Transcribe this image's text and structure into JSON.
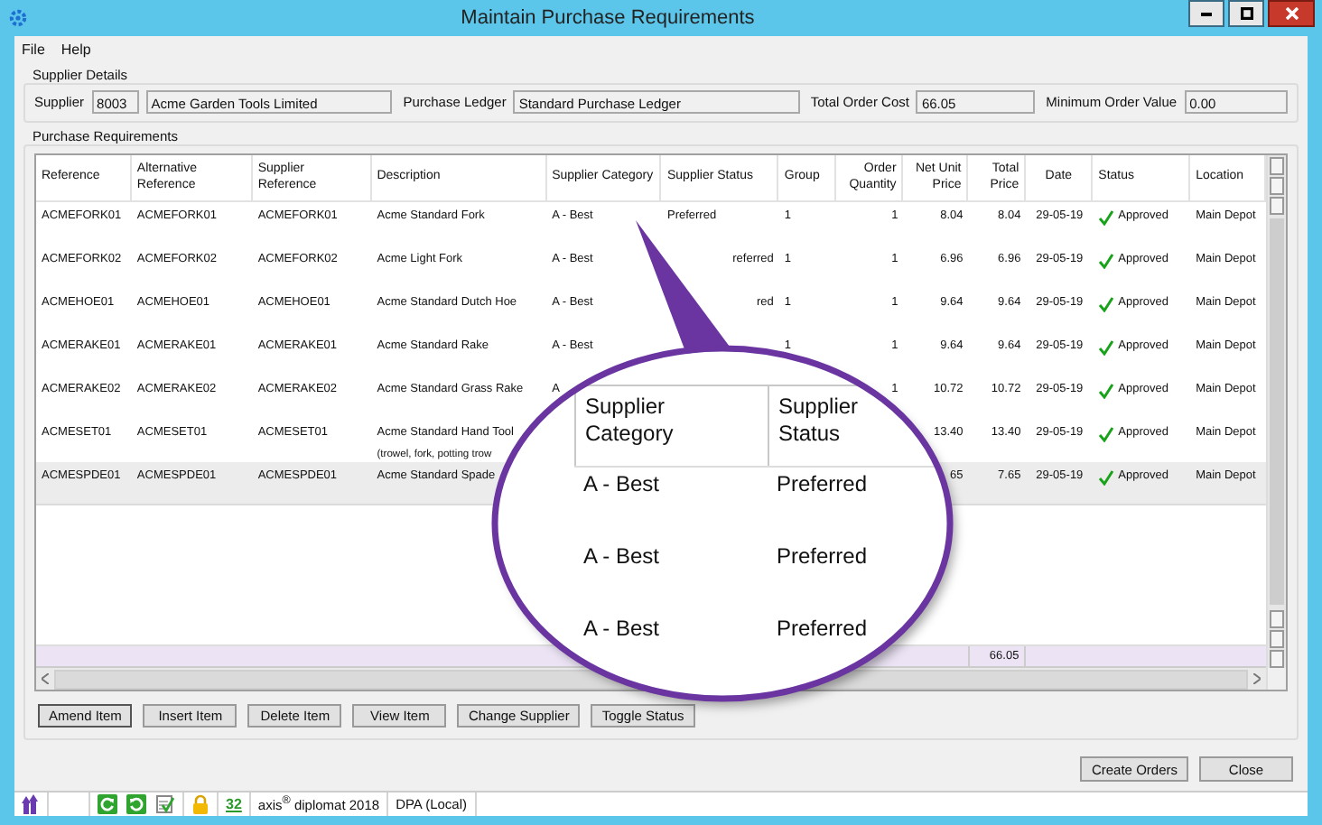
{
  "window": {
    "title": "Maintain Purchase Requirements"
  },
  "menu": [
    "File",
    "Help"
  ],
  "supplier_details": {
    "title": "Supplier Details",
    "fields": [
      {
        "label": "Supplier",
        "boxes": [
          "8003",
          "Acme Garden Tools Limited"
        ]
      },
      {
        "label": "Purchase Ledger",
        "boxes": [
          "Standard Purchase Ledger"
        ]
      },
      {
        "label": "Total Order Cost",
        "boxes": [
          "66.05"
        ]
      },
      {
        "label": "Minimum Order Value",
        "boxes": [
          "0.00"
        ]
      }
    ]
  },
  "requirements": {
    "title": "Purchase Requirements",
    "columns": [
      "Reference",
      "Alternative Reference",
      "Supplier Reference",
      "Description",
      "Supplier Category",
      "Supplier Status",
      "Group",
      "Order Quantity",
      "Net Unit Price",
      "Total Price",
      "Date",
      "Status",
      "Location"
    ],
    "rows": [
      {
        "selected": false,
        "cells": [
          "ACMEFORK01",
          "ACMEFORK01",
          "ACMEFORK01",
          "Acme Standard Fork",
          "A - Best",
          "Preferred",
          "1",
          "1",
          "8.04",
          "8.04",
          "29-05-19",
          "Approved",
          "Main Depot"
        ]
      },
      {
        "selected": false,
        "cells": [
          "ACMEFORK02",
          "ACMEFORK02",
          "ACMEFORK02",
          "Acme Light Fork",
          "A - Best",
          {
            "text": "referred",
            "kind": "clipped"
          },
          "1",
          "1",
          "6.96",
          "6.96",
          "29-05-19",
          "Approved",
          "Main Depot"
        ]
      },
      {
        "selected": false,
        "cells": [
          "ACMEHOE01",
          "ACMEHOE01",
          "ACMEHOE01",
          "Acme Standard Dutch Hoe",
          "A - Best",
          {
            "text": "red",
            "kind": "clipped"
          },
          "1",
          "1",
          "9.64",
          "9.64",
          "29-05-19",
          "Approved",
          "Main Depot"
        ]
      },
      {
        "selected": false,
        "cells": [
          "ACMERAKE01",
          "ACMERAKE01",
          "ACMERAKE01",
          "Acme Standard Rake",
          "A - Best",
          null,
          "1",
          "1",
          "9.64",
          "9.64",
          "29-05-19",
          "Approved",
          "Main Depot"
        ]
      },
      {
        "selected": false,
        "cells": [
          "ACMERAKE02",
          "ACMERAKE02",
          "ACMERAKE02",
          "Acme Standard Grass Rake",
          "A",
          null,
          null,
          "1",
          "10.72",
          "10.72",
          "29-05-19",
          "Approved",
          "Main Depot"
        ]
      },
      {
        "selected": false,
        "cells": [
          "ACMESET01",
          "ACMESET01",
          "ACMESET01",
          "Acme Standard Hand Tool",
          null,
          null,
          null,
          null,
          "13.40",
          "13.40",
          "29-05-19",
          "Approved",
          "Main Depot"
        ],
        "description_line_2": "(trowel, fork, potting trow"
      },
      {
        "selected": true,
        "cells": [
          "ACMESPDE01",
          "ACMESPDE01",
          "ACMESPDE01",
          "Acme Standard Spade",
          null,
          null,
          null,
          null,
          {
            "text": "65",
            "kind": "clipped"
          },
          "7.65",
          "29-05-19",
          "Approved",
          "Main Depot"
        ]
      }
    ],
    "total_price_sum": "66.05",
    "buttons": [
      "Amend Item",
      "Insert Item",
      "Delete Item",
      "View Item",
      "Change Supplier",
      "Toggle Status"
    ]
  },
  "callout": {
    "columns": [
      "Supplier Category",
      "Supplier Status"
    ],
    "rows": [
      [
        "A - Best",
        "Preferred"
      ],
      [
        "A - Best",
        "Preferred"
      ],
      [
        "A - Best",
        "Preferred"
      ]
    ]
  },
  "footer_buttons": [
    "Create Orders",
    "Close"
  ],
  "status_bar": {
    "count": "32",
    "product": "axis$^{®}$ diplomat 2018",
    "database": "DPA (Local)"
  }
}
